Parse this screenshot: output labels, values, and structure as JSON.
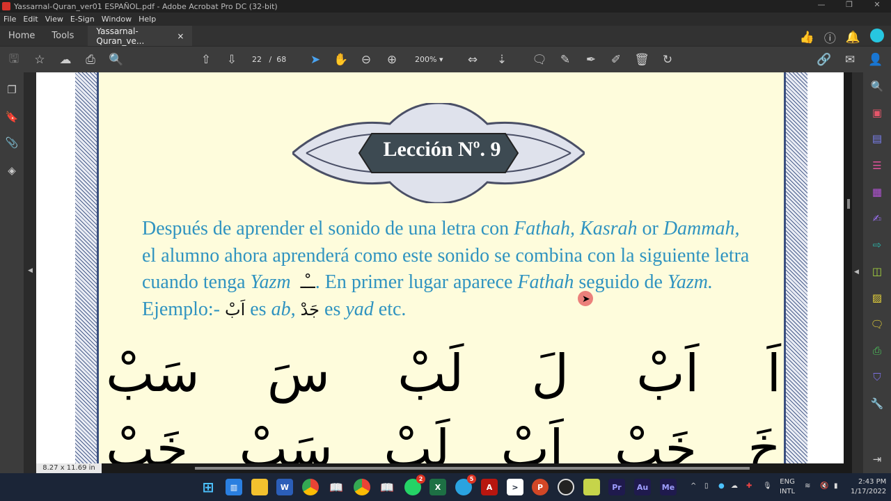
{
  "window": {
    "title": "Yassarnal-Quran_ver01 ESPAÑOL.pdf - Adobe Acrobat Pro DC (32-bit)"
  },
  "menu": [
    "File",
    "Edit",
    "View",
    "E-Sign",
    "Window",
    "Help"
  ],
  "tabs": {
    "home": "Home",
    "tools": "Tools",
    "doc": "Yassarnal-Quran_ve...",
    "close": "×"
  },
  "toolbar": {
    "page_current": "22",
    "page_sep": "/",
    "page_total": "68",
    "zoom": "200%"
  },
  "document": {
    "lesson_title": "Lección Nº. 9",
    "paragraph": {
      "p1": "Después de aprender el sonido de una letra con ",
      "fathah": "Fathah,",
      "kasrah": " Kasrah",
      "p2": " or ",
      "dammah": "Dammah,",
      "p3": " el alumno ahora aprenderá como este sonido se combina con la siguiente letra cuando tenga ",
      "yazm": "Yazm",
      "yazm_sign": "ــْـ",
      "p4": ". En primer lugar aparece ",
      "fathah2": "Fathah",
      "p5": " seguido de ",
      "yazm2": "Yazm.",
      "p6": " Ejemplo:- ",
      "ex1_ar": "اَبْ",
      "p7": " es ",
      "ex1": "ab,",
      "ex2_ar": "جَدْ",
      "p8": " es ",
      "ex2": "yad",
      "p9": " etc."
    },
    "row1": [
      "اَ",
      "اَبْ",
      "لَ",
      "لَبْ",
      "سَ",
      "سَبْ"
    ],
    "row2": [
      "خَ",
      "خَبْ",
      "اَبْ",
      "لَبْ",
      "سَبْ",
      "خَبْ"
    ],
    "page_size": "8.27 x 11.69 in"
  },
  "taskbar": {
    "whatsapp_badge": "2",
    "telegram_badge": "5",
    "lang1": "ENG",
    "lang2": "INTL",
    "time": "2:43 PM",
    "date": "1/17/2022"
  }
}
